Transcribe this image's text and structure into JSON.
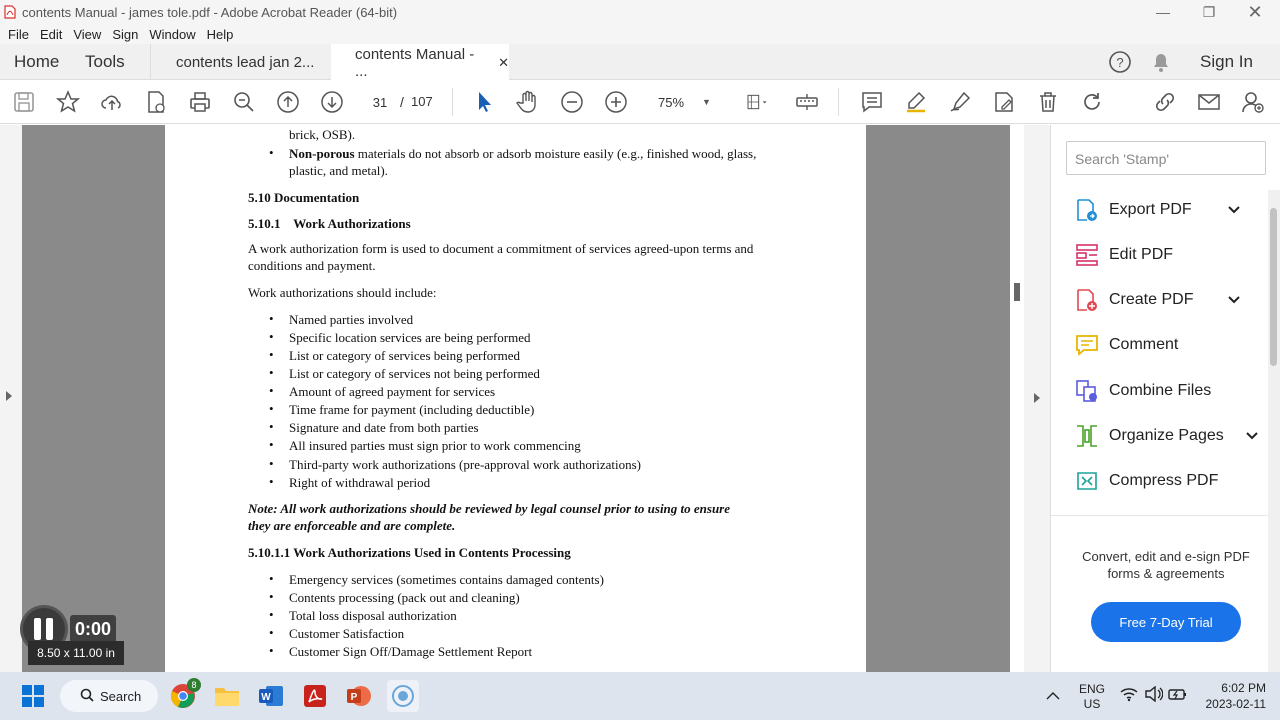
{
  "window": {
    "title": "contents Manual - james tole.pdf - Adobe Acrobat Reader (64-bit)"
  },
  "menu": [
    "File",
    "Edit",
    "View",
    "Sign",
    "Window",
    "Help"
  ],
  "tabs": {
    "home": "Home",
    "tools": "Tools",
    "doc1": "contents lead jan 2...",
    "doc2": "contents Manual - ...",
    "sign_in": "Sign In"
  },
  "toolbar": {
    "page_current": "31",
    "page_sep": "/",
    "page_total": "107",
    "zoom": "75%"
  },
  "document": {
    "lines": [
      {
        "text": "brick, OSB).",
        "bold": false,
        "bullet": false
      },
      {
        "text": "Non-porous",
        "bold": true,
        "bullet": true,
        "rest": " materials do not absorb or adsorb moisture easily (e.g., finished wood, glass,"
      },
      {
        "text": "plastic, and metal).",
        "bold": false,
        "bullet": false
      },
      {
        "text": "5.10  Documentation",
        "bold": true,
        "bullet": false
      },
      {
        "text": "5.10.1    Work Authorizations",
        "bold": true,
        "bullet": false
      },
      {
        "text": "A work authorization form is used to document a commitment of services agreed-upon terms and",
        "bold": false,
        "bullet": false
      },
      {
        "text": "conditions and payment.",
        "bold": false,
        "bullet": false
      },
      {
        "text": "Work authorizations should include:",
        "bold": false,
        "bullet": false
      },
      {
        "text": "Named parties involved",
        "bold": false,
        "bullet": true
      },
      {
        "text": "Specific location services are being performed",
        "bold": false,
        "bullet": true
      },
      {
        "text": "List or category of services being performed",
        "bold": false,
        "bullet": true
      },
      {
        "text": "List or category of services not being performed",
        "bold": false,
        "bullet": true
      },
      {
        "text": "Amount of agreed payment for services",
        "bold": false,
        "bullet": true
      },
      {
        "text": "Time frame for payment (including deductible)",
        "bold": false,
        "bullet": true
      },
      {
        "text": "Signature and date from both parties",
        "bold": false,
        "bullet": true
      },
      {
        "text": "All insured parties must sign prior to work commencing",
        "bold": false,
        "bullet": true
      },
      {
        "text": "Third-party work authorizations (pre-approval work authorizations)",
        "bold": false,
        "bullet": true
      },
      {
        "text": "Right of withdrawal period",
        "bold": false,
        "bullet": true
      },
      {
        "text": "Note: All work authorizations should be reviewed by legal counsel prior to using to ensure",
        "bold": true,
        "bullet": false
      },
      {
        "text": "they are enforceable and are complete.",
        "bold": true,
        "bullet": false
      },
      {
        "text": "5.10.1.1 Work Authorizations Used in Contents Processing",
        "bold": true,
        "bullet": false
      },
      {
        "text": "Emergency services (sometimes contains damaged contents)",
        "bold": false,
        "bullet": true
      },
      {
        "text": "Contents processing (pack out and cleaning)",
        "bold": false,
        "bullet": true
      },
      {
        "text": "Total loss disposal authorization",
        "bold": false,
        "bullet": true
      },
      {
        "text": "Customer Satisfaction",
        "bold": false,
        "bullet": true
      },
      {
        "text": "Customer Sign Off/Damage Settlement Report",
        "bold": false,
        "bullet": true
      }
    ]
  },
  "rightpane": {
    "search_placeholder": "Search 'Stamp'",
    "tools": [
      {
        "label": "Export PDF",
        "icon": "export-pdf-icon",
        "color": "#1f8fd6",
        "chevron": true
      },
      {
        "label": "Edit PDF",
        "icon": "edit-pdf-icon",
        "color": "#d6336c",
        "chevron": false
      },
      {
        "label": "Create PDF",
        "icon": "create-pdf-icon",
        "color": "#e34850",
        "chevron": true
      },
      {
        "label": "Comment",
        "icon": "comment-icon",
        "color": "#e8b400",
        "chevron": false
      },
      {
        "label": "Combine Files",
        "icon": "combine-files-icon",
        "color": "#5c5ce0",
        "chevron": false
      },
      {
        "label": "Organize Pages",
        "icon": "organize-pages-icon",
        "color": "#4aa32a",
        "chevron": true
      },
      {
        "label": "Compress PDF",
        "icon": "compress-pdf-icon",
        "color": "#1aa39b",
        "chevron": false
      }
    ],
    "promo_text": "Convert, edit and e-sign PDF forms & agreements",
    "trial_button": "Free 7-Day Trial"
  },
  "overlay": {
    "timer": "0:00",
    "page_size": "8.50 x 11.00 in"
  },
  "taskbar": {
    "search": "Search",
    "lang1": "ENG",
    "lang2": "US",
    "time": "6:02 PM",
    "date": "2023-02-11",
    "chrome_badge": "8"
  },
  "colors": {
    "accent": "#1a73e8",
    "doc_bg": "#8a8a8a"
  }
}
